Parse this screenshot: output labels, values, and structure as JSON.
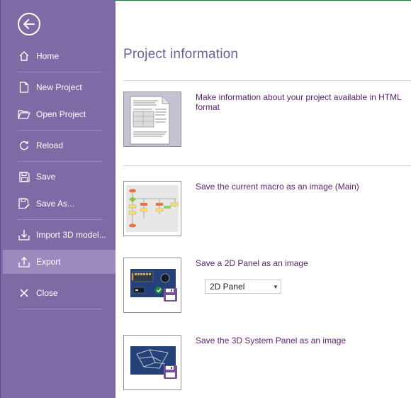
{
  "sidebar": {
    "items": [
      {
        "label": "Home",
        "icon": "home-icon"
      },
      {
        "label": "New Project",
        "icon": "new-document-icon"
      },
      {
        "label": "Open Project",
        "icon": "open-folder-icon"
      },
      {
        "label": "Reload",
        "icon": "reload-icon"
      },
      {
        "label": "Save",
        "icon": "save-icon"
      },
      {
        "label": "Save As...",
        "icon": "save-as-icon"
      },
      {
        "label": "Import 3D model...",
        "icon": "import-icon"
      },
      {
        "label": "Export",
        "icon": "export-icon"
      },
      {
        "label": "Close",
        "icon": "close-icon"
      }
    ],
    "active_item": "Export",
    "back_icon": "back-arrow-icon"
  },
  "main": {
    "title": "Project information",
    "options": [
      {
        "label": "Make information about your project available in HTML format",
        "thumb": "html-document-thumbnail"
      },
      {
        "label": "Save the current macro as an image (Main)",
        "thumb": "flowchart-thumbnail"
      },
      {
        "label": "Save a 2D Panel as an image",
        "thumb": "2d-panel-thumbnail"
      },
      {
        "label": "Save the 3D System Panel as an image",
        "thumb": "3d-panel-thumbnail"
      }
    ],
    "panel_select": {
      "value": "2D Panel"
    }
  },
  "colors": {
    "sidebar_bg": "#7e6aa5",
    "sidebar_active": "#9a8abd",
    "title": "#6f5e98",
    "option_text": "#5a1f6e"
  }
}
